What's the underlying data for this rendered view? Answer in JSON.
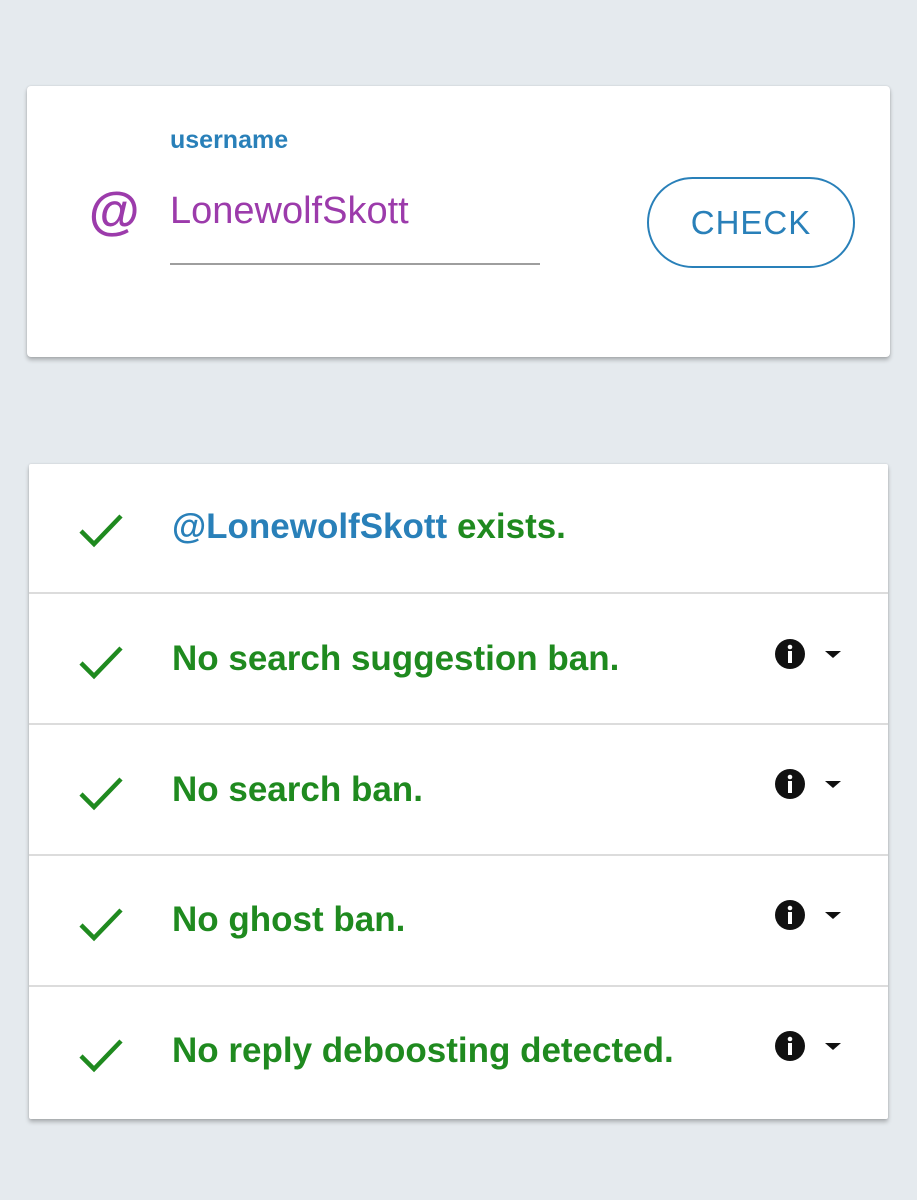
{
  "search": {
    "label": "username",
    "at_symbol": "@",
    "value": "LonewolfSkott",
    "button_label": "CHECK"
  },
  "results": [
    {
      "handle": "@LonewolfSkott",
      "text": " exists.",
      "has_info": false,
      "icon": "check-icon"
    },
    {
      "text": "No search suggestion ban.",
      "has_info": true,
      "icon": "check-icon"
    },
    {
      "text": "No search ban.",
      "has_info": true,
      "icon": "check-icon"
    },
    {
      "text": "No ghost ban.",
      "has_info": true,
      "icon": "check-icon"
    },
    {
      "text": "No reply deboosting detected.",
      "has_info": true,
      "icon": "check-icon"
    }
  ],
  "colors": {
    "background": "#e5eaee",
    "accent_blue": "#2980b9",
    "accent_purple": "#9c3bab",
    "success_green": "#1f8a1f"
  }
}
